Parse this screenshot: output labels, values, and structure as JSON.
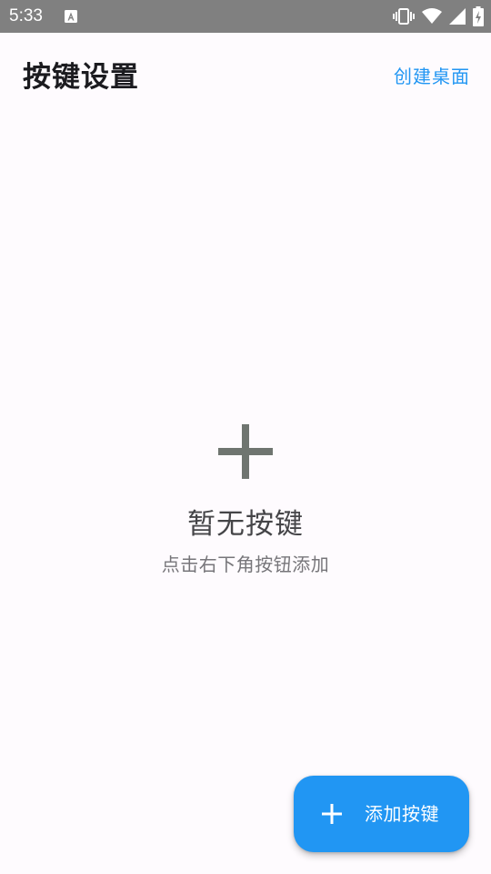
{
  "status_bar": {
    "time": "5:33",
    "notification_icon": "app-notification-icon",
    "icons": [
      "vibrate-icon",
      "wifi-icon",
      "signal-icon",
      "battery-charging-icon"
    ]
  },
  "app_bar": {
    "title": "按键设置",
    "action_label": "创建桌面"
  },
  "empty_state": {
    "icon": "plus-icon",
    "title": "暂无按键",
    "subtitle": "点击右下角按钮添加"
  },
  "fab": {
    "icon": "plus-icon",
    "label": "添加按键"
  },
  "colors": {
    "accent": "#2196f3",
    "background": "#fefbfe",
    "status_bar": "#808080"
  }
}
